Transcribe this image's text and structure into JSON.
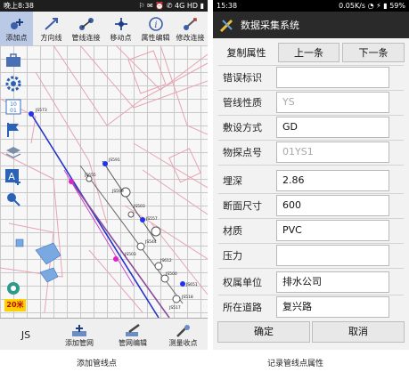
{
  "left_screen": {
    "status": {
      "time": "晚上8:38",
      "network": "4G HD"
    },
    "toolbar": [
      {
        "label": "添加点",
        "icon": "add-point-icon",
        "active": true
      },
      {
        "label": "方向线",
        "icon": "direction-line-icon"
      },
      {
        "label": "管线连接",
        "icon": "pipe-connect-icon"
      },
      {
        "label": "移动点",
        "icon": "move-point-icon"
      },
      {
        "label": "属性编辑",
        "icon": "info-icon"
      },
      {
        "label": "修改连接",
        "icon": "edit-connection-icon"
      }
    ],
    "side_tools": [
      "toolbox-icon",
      "gear-icon",
      "layers-number-icon",
      "flag-icon",
      "stack-icon",
      "text-add-icon",
      "pin-icon",
      "locate-icon"
    ],
    "map_labels": [
      "JS573",
      "JS591",
      "JS655",
      "JS599",
      "JS503",
      "JS557",
      "JS544",
      "JS503",
      "JS612",
      "JS500",
      "JS518",
      "JS517",
      "JS651"
    ],
    "scale_label": "20米",
    "bottom_bar": {
      "js_label": "JS",
      "buttons": [
        "添加管网",
        "管网编辑",
        "测量收点"
      ]
    },
    "caption": "添加管线点"
  },
  "right_screen": {
    "status": {
      "time": "15:38",
      "speed": "0.05K/s",
      "battery": "59%"
    },
    "title": "数据采集系统",
    "tabs": [
      "复制属性",
      "上一条",
      "下一条"
    ],
    "fields": [
      {
        "label": "错误标识",
        "value": "",
        "enabled": true
      },
      {
        "label": "管线性质",
        "value": "YS",
        "enabled": false
      },
      {
        "label": "敷设方式",
        "value": "GD",
        "enabled": true
      },
      {
        "label": "物探点号",
        "value": "01YS1",
        "enabled": false
      },
      {
        "label": "埋深",
        "value": "2.86",
        "enabled": true
      },
      {
        "label": "断面尺寸",
        "value": "600",
        "enabled": true
      },
      {
        "label": "材质",
        "value": "PVC",
        "enabled": true
      },
      {
        "label": "压力",
        "value": "",
        "enabled": true
      },
      {
        "label": "权属单位",
        "value": "排水公司",
        "enabled": true
      },
      {
        "label": "所在道路",
        "value": "复兴路",
        "enabled": true
      }
    ],
    "buttons": {
      "confirm": "确定",
      "cancel": "取消"
    },
    "caption": "记录管线点属性"
  }
}
